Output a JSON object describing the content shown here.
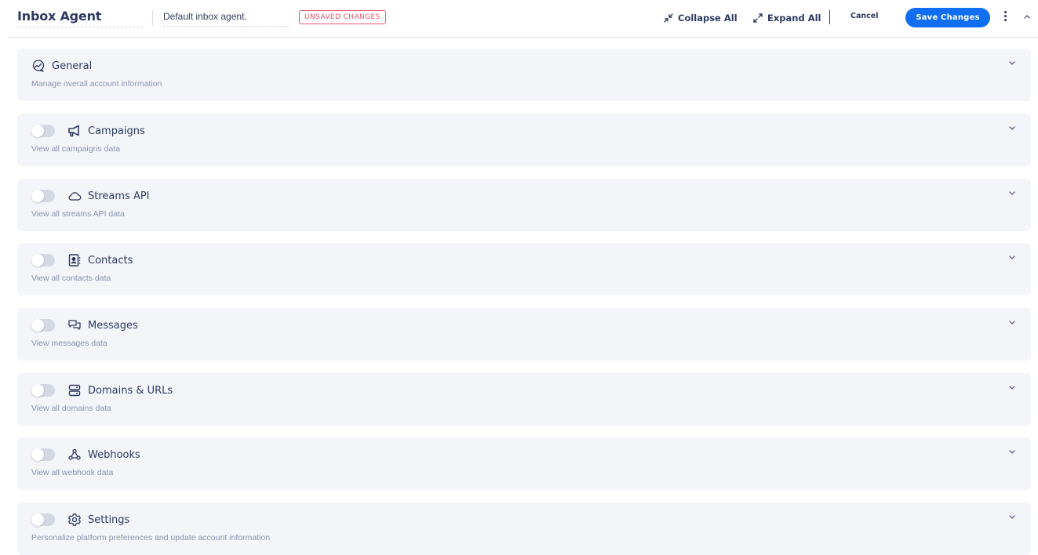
{
  "header": {
    "title": "Inbox Agent",
    "description": "Default inbox agent.",
    "badge": "UNSAVED CHANGES",
    "collapse_all": "Collapse All",
    "expand_all": "Expand All",
    "cancel": "Cancel",
    "save": "Save Changes"
  },
  "colors": {
    "primary": "#0f6ef2",
    "badge": "#e5526b",
    "section_bg": "#f3f5f9",
    "text": "#2f3a62",
    "muted": "#8a93ad"
  },
  "sections": [
    {
      "title": "General",
      "subtitle": "Manage overall account information",
      "icon": "chart-bubble-icon",
      "has_toggle": false
    },
    {
      "title": "Campaigns",
      "subtitle": "View all campaigns data",
      "icon": "megaphone-icon",
      "has_toggle": true,
      "enabled": false
    },
    {
      "title": "Streams API",
      "subtitle": "View all streams API data",
      "icon": "cloud-icon",
      "has_toggle": true,
      "enabled": false
    },
    {
      "title": "Contacts",
      "subtitle": "View all contacts data",
      "icon": "contact-book-icon",
      "has_toggle": true,
      "enabled": false
    },
    {
      "title": "Messages",
      "subtitle": "View messages data",
      "icon": "chat-bubbles-icon",
      "has_toggle": true,
      "enabled": false
    },
    {
      "title": "Domains & URLs",
      "subtitle": "View all domains data",
      "icon": "server-icon",
      "has_toggle": true,
      "enabled": false
    },
    {
      "title": "Webhooks",
      "subtitle": "View all webhook data",
      "icon": "webhook-icon",
      "has_toggle": true,
      "enabled": false
    },
    {
      "title": "Settings",
      "subtitle": "Personalize platform preferences and update account information",
      "icon": "gear-icon",
      "has_toggle": true,
      "enabled": false
    }
  ]
}
